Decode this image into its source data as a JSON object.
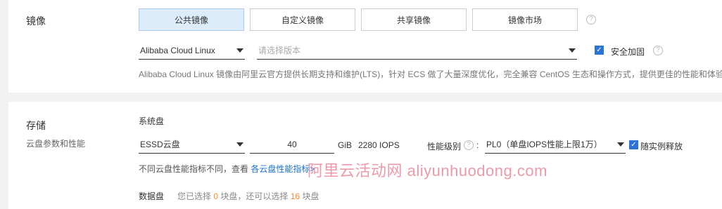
{
  "image": {
    "title": "镜像",
    "tabs": [
      {
        "label": "公共镜像",
        "active": true
      },
      {
        "label": "自定义镜像",
        "active": false
      },
      {
        "label": "共享镜像",
        "active": false
      },
      {
        "label": "镜像市场",
        "active": false
      }
    ],
    "os_select": "Alibaba Cloud Linux",
    "version_placeholder": "请选择版本",
    "security_label": "安全加固",
    "security_checked": true,
    "description": "Alibaba Cloud Linux 镜像由阿里云官方提供长期支持和维护(LTS)，针对 ECS 做了大量深度优化，完全兼容 CentOS 生态和操作方式，提供更佳的性能和体验。"
  },
  "storage": {
    "title": "存储",
    "subtitle": "云盘参数和性能",
    "system_disk_label": "系统盘",
    "disk_type": "ESSD云盘",
    "size": "40",
    "unit": "GiB",
    "iops": "2280 IOPS",
    "perf_level_label": "性能级别",
    "perf_level_value": "PL0（单盘IOPS性能上限1万）",
    "release_label": "随实例释放",
    "release_checked": true,
    "hint_prefix": "不同云盘性能指标不同，查看",
    "hint_link": "各云盘性能指标>",
    "data_disk_label": "数据盘",
    "data_disk_text_1": "您已选择",
    "data_disk_selected": "0",
    "data_disk_text_2": "块盘，还可以选择",
    "data_disk_remaining": "16",
    "data_disk_text_3": "块盘"
  },
  "watermark": "阿里云活动网 aliyunhuodong.com",
  "colors": {
    "accent": "#2b74d6",
    "active_tab_bg": "#dcecfa",
    "link": "#1a6fd1",
    "orange": "#f08c2c"
  }
}
